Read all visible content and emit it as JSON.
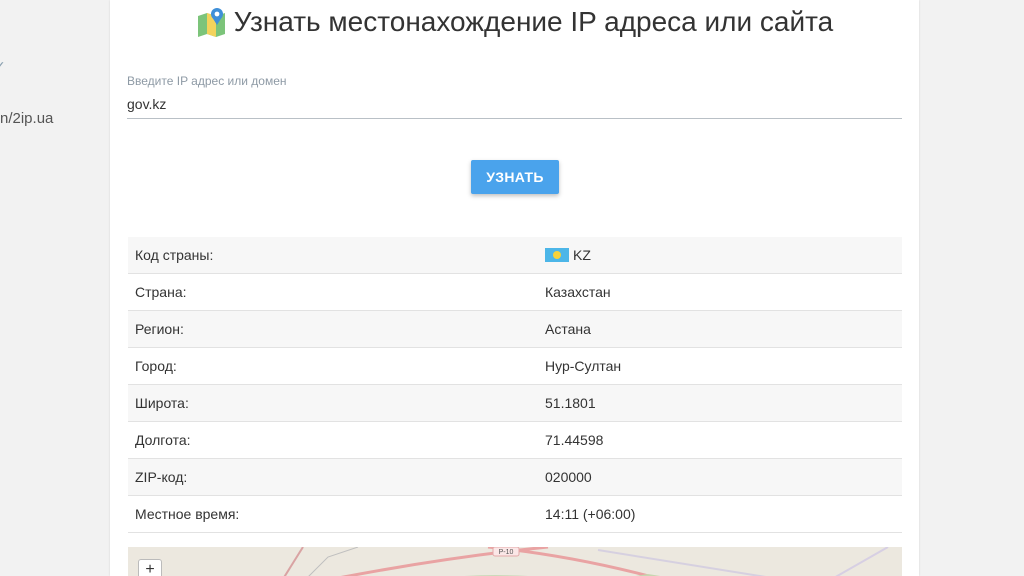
{
  "left": {
    "link_text": "n/2ip.ua"
  },
  "header": {
    "title": "Узнать местонахождение IP адреса или сайта"
  },
  "search": {
    "label": "Введите IP адрес или домен",
    "value": "gov.kz",
    "button_label": "УЗНАТЬ"
  },
  "results": [
    {
      "key": "Код страны:",
      "value": "KZ",
      "icon": "kazakhstan-flag-icon"
    },
    {
      "key": "Страна:",
      "value": "Казахстан"
    },
    {
      "key": "Регион:",
      "value": "Астана"
    },
    {
      "key": "Город:",
      "value": "Нур-Султан"
    },
    {
      "key": "Широта:",
      "value": "51.1801"
    },
    {
      "key": "Долгота:",
      "value": "71.44598"
    },
    {
      "key": "ZIP-код:",
      "value": "020000"
    },
    {
      "key": "Местное время:",
      "value": "14:11 (+06:00)"
    }
  ],
  "map": {
    "zoom_in_label": "+",
    "road_label": "P-10"
  },
  "colors": {
    "button": "#4aa3ec",
    "flag_blue": "#4cb6e8",
    "flag_sun": "#f6d23a"
  }
}
